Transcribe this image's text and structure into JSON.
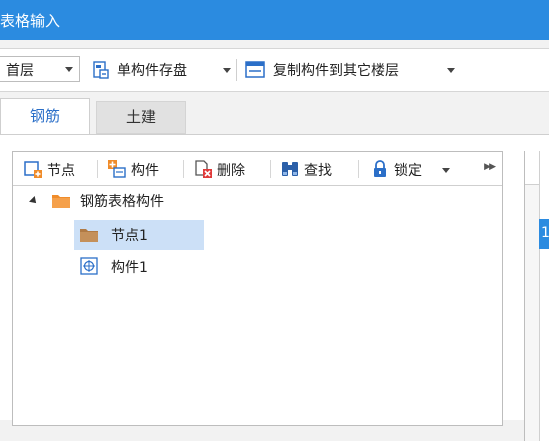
{
  "window": {
    "title": "表格输入"
  },
  "toolbar": {
    "floor_select_value": "首层",
    "save_component_label": "单构件存盘",
    "copy_to_floors_label": "复制构件到其它楼层"
  },
  "tabs": [
    {
      "label": "钢筋",
      "active": true
    },
    {
      "label": "土建",
      "active": false
    }
  ],
  "tree_toolbar": {
    "node_label": "节点",
    "component_label": "构件",
    "delete_label": "删除",
    "find_label": "查找",
    "lock_label": "锁定"
  },
  "tree": {
    "root_label": "钢筋表格构件",
    "children": [
      {
        "label": "节点1",
        "selected": true,
        "icon": "folder-icon"
      },
      {
        "label": "构件1",
        "selected": false,
        "icon": "component-icon"
      }
    ]
  },
  "right_panel": {
    "selected_row_number": "1"
  },
  "colors": {
    "accent": "#2b8be0",
    "selection": "#cce0f7",
    "folder": "#f08c2a"
  }
}
